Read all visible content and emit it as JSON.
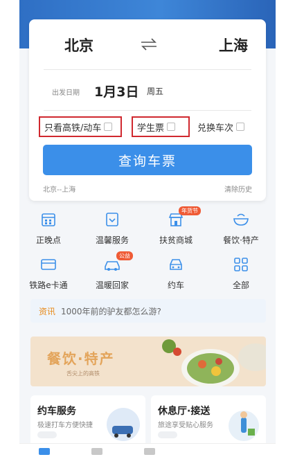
{
  "route": {
    "from_city": "北京",
    "to_city": "上海",
    "date_label": "出发日期",
    "date": "1月3日",
    "weekday": "周五"
  },
  "options": {
    "gaotie_label": "只看高铁/动车",
    "student_label": "学生票",
    "exchange_label": "兑换车次"
  },
  "query_button": "查询车票",
  "history": {
    "recent": "北京--上海",
    "clear": "清除历史"
  },
  "services_row1": [
    {
      "label": "正晚点",
      "icon": "calendar-icon"
    },
    {
      "label": "温馨服务",
      "icon": "service-icon"
    },
    {
      "label": "扶贫商城",
      "icon": "shop-icon",
      "tag": "年货节"
    },
    {
      "label": "餐饮·特产",
      "icon": "bowl-icon"
    }
  ],
  "services_row2": [
    {
      "label": "铁路e卡通",
      "icon": "card-icon"
    },
    {
      "label": "温暖回家",
      "icon": "home-car-icon",
      "tag": "公益"
    },
    {
      "label": "约车",
      "icon": "car-icon"
    },
    {
      "label": "全部",
      "icon": "grid-icon"
    }
  ],
  "news": {
    "tag": "资讯",
    "text": "1000年前的驴友都怎么游?"
  },
  "promo": {
    "title": "餐饮·特产",
    "subtitle": "舌尖上的高铁"
  },
  "service_cards": [
    {
      "title": "约车服务",
      "subtitle": "极速打车方便快捷"
    },
    {
      "title": "休息厅·接送",
      "subtitle": "旅途享受贴心服务"
    }
  ],
  "colors": {
    "primary": "#3b8fe9",
    "highlight_border": "#d0282e",
    "news_tag": "#e88a1a"
  }
}
